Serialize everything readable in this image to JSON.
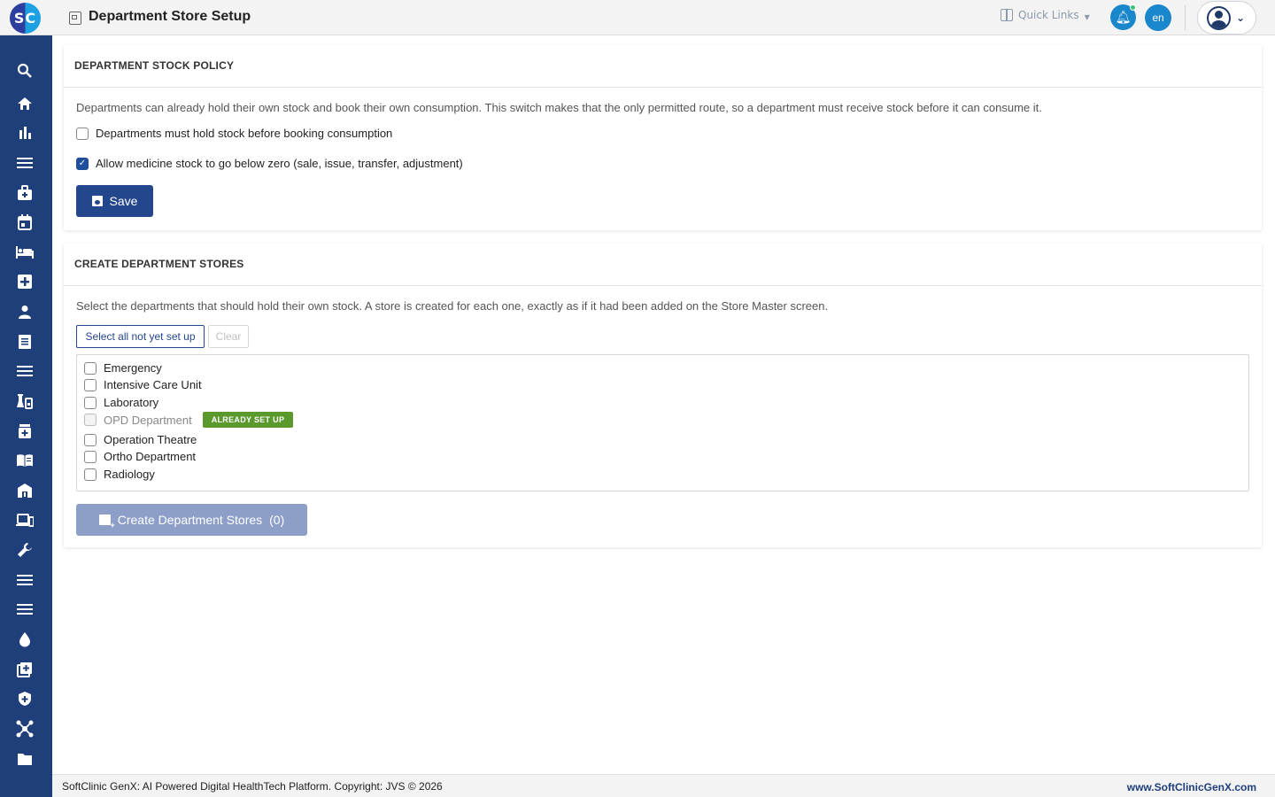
{
  "app": {
    "logo_text": "SC",
    "page_title": "Department Store Setup"
  },
  "topbar": {
    "quick_links_label": "Quick Links",
    "language_code": "en"
  },
  "sidebar": {
    "icons": [
      "search-icon",
      "home-icon",
      "chart-icon",
      "menu-icon",
      "medical-bag-icon",
      "calendar-icon",
      "bed-icon",
      "medical-plus-icon",
      "user-icon",
      "document-icon",
      "list-icon",
      "lab-icon",
      "pharmacy-icon",
      "book-icon",
      "building-icon",
      "devices-icon",
      "wrench-icon",
      "list-icon",
      "list-icon",
      "blood-drop-icon",
      "add-box-icon",
      "shield-icon",
      "network-icon",
      "folder-icon"
    ]
  },
  "policy": {
    "header": "DEPARTMENT STOCK POLICY",
    "description": "Departments can already hold their own stock and book their own consumption. This switch makes that the only permitted route, so a department must receive stock before it can consume it.",
    "options": [
      {
        "label": "Departments must hold stock before booking consumption",
        "checked": false
      },
      {
        "label": "Allow medicine stock to go below zero (sale, issue, transfer, adjustment)",
        "checked": true
      }
    ],
    "save_label": "Save"
  },
  "create": {
    "header": "CREATE DEPARTMENT STORES",
    "description": "Select the departments that should hold their own stock. A store is created for each one, exactly as if it had been added on the Store Master screen.",
    "select_all_label": "Select all not yet set up",
    "clear_label": "Clear",
    "departments": [
      {
        "name": "Emergency",
        "checked": false,
        "already_set_up": false
      },
      {
        "name": "Intensive Care Unit",
        "checked": false,
        "already_set_up": false
      },
      {
        "name": "Laboratory",
        "checked": false,
        "already_set_up": false
      },
      {
        "name": "OPD Department",
        "checked": false,
        "already_set_up": true
      },
      {
        "name": "Operation Theatre",
        "checked": false,
        "already_set_up": false
      },
      {
        "name": "Ortho Department",
        "checked": false,
        "already_set_up": false
      },
      {
        "name": "Radiology",
        "checked": false,
        "already_set_up": false
      }
    ],
    "already_set_up_badge": "ALREADY SET UP",
    "create_button_label": "Create Department Stores",
    "create_count": "(0)"
  },
  "footer": {
    "copyright": "SoftClinic GenX: AI Powered Digital HealthTech Platform. Copyright: JVS © 2026",
    "website": "www.SoftClinicGenX.com"
  },
  "colors": {
    "sidebar": "#1f3f7a",
    "primary_button": "#24468d",
    "disabled_button": "#8d9fc8",
    "badge_green": "#5a9a2c",
    "accent_blue": "#1a86cc"
  }
}
